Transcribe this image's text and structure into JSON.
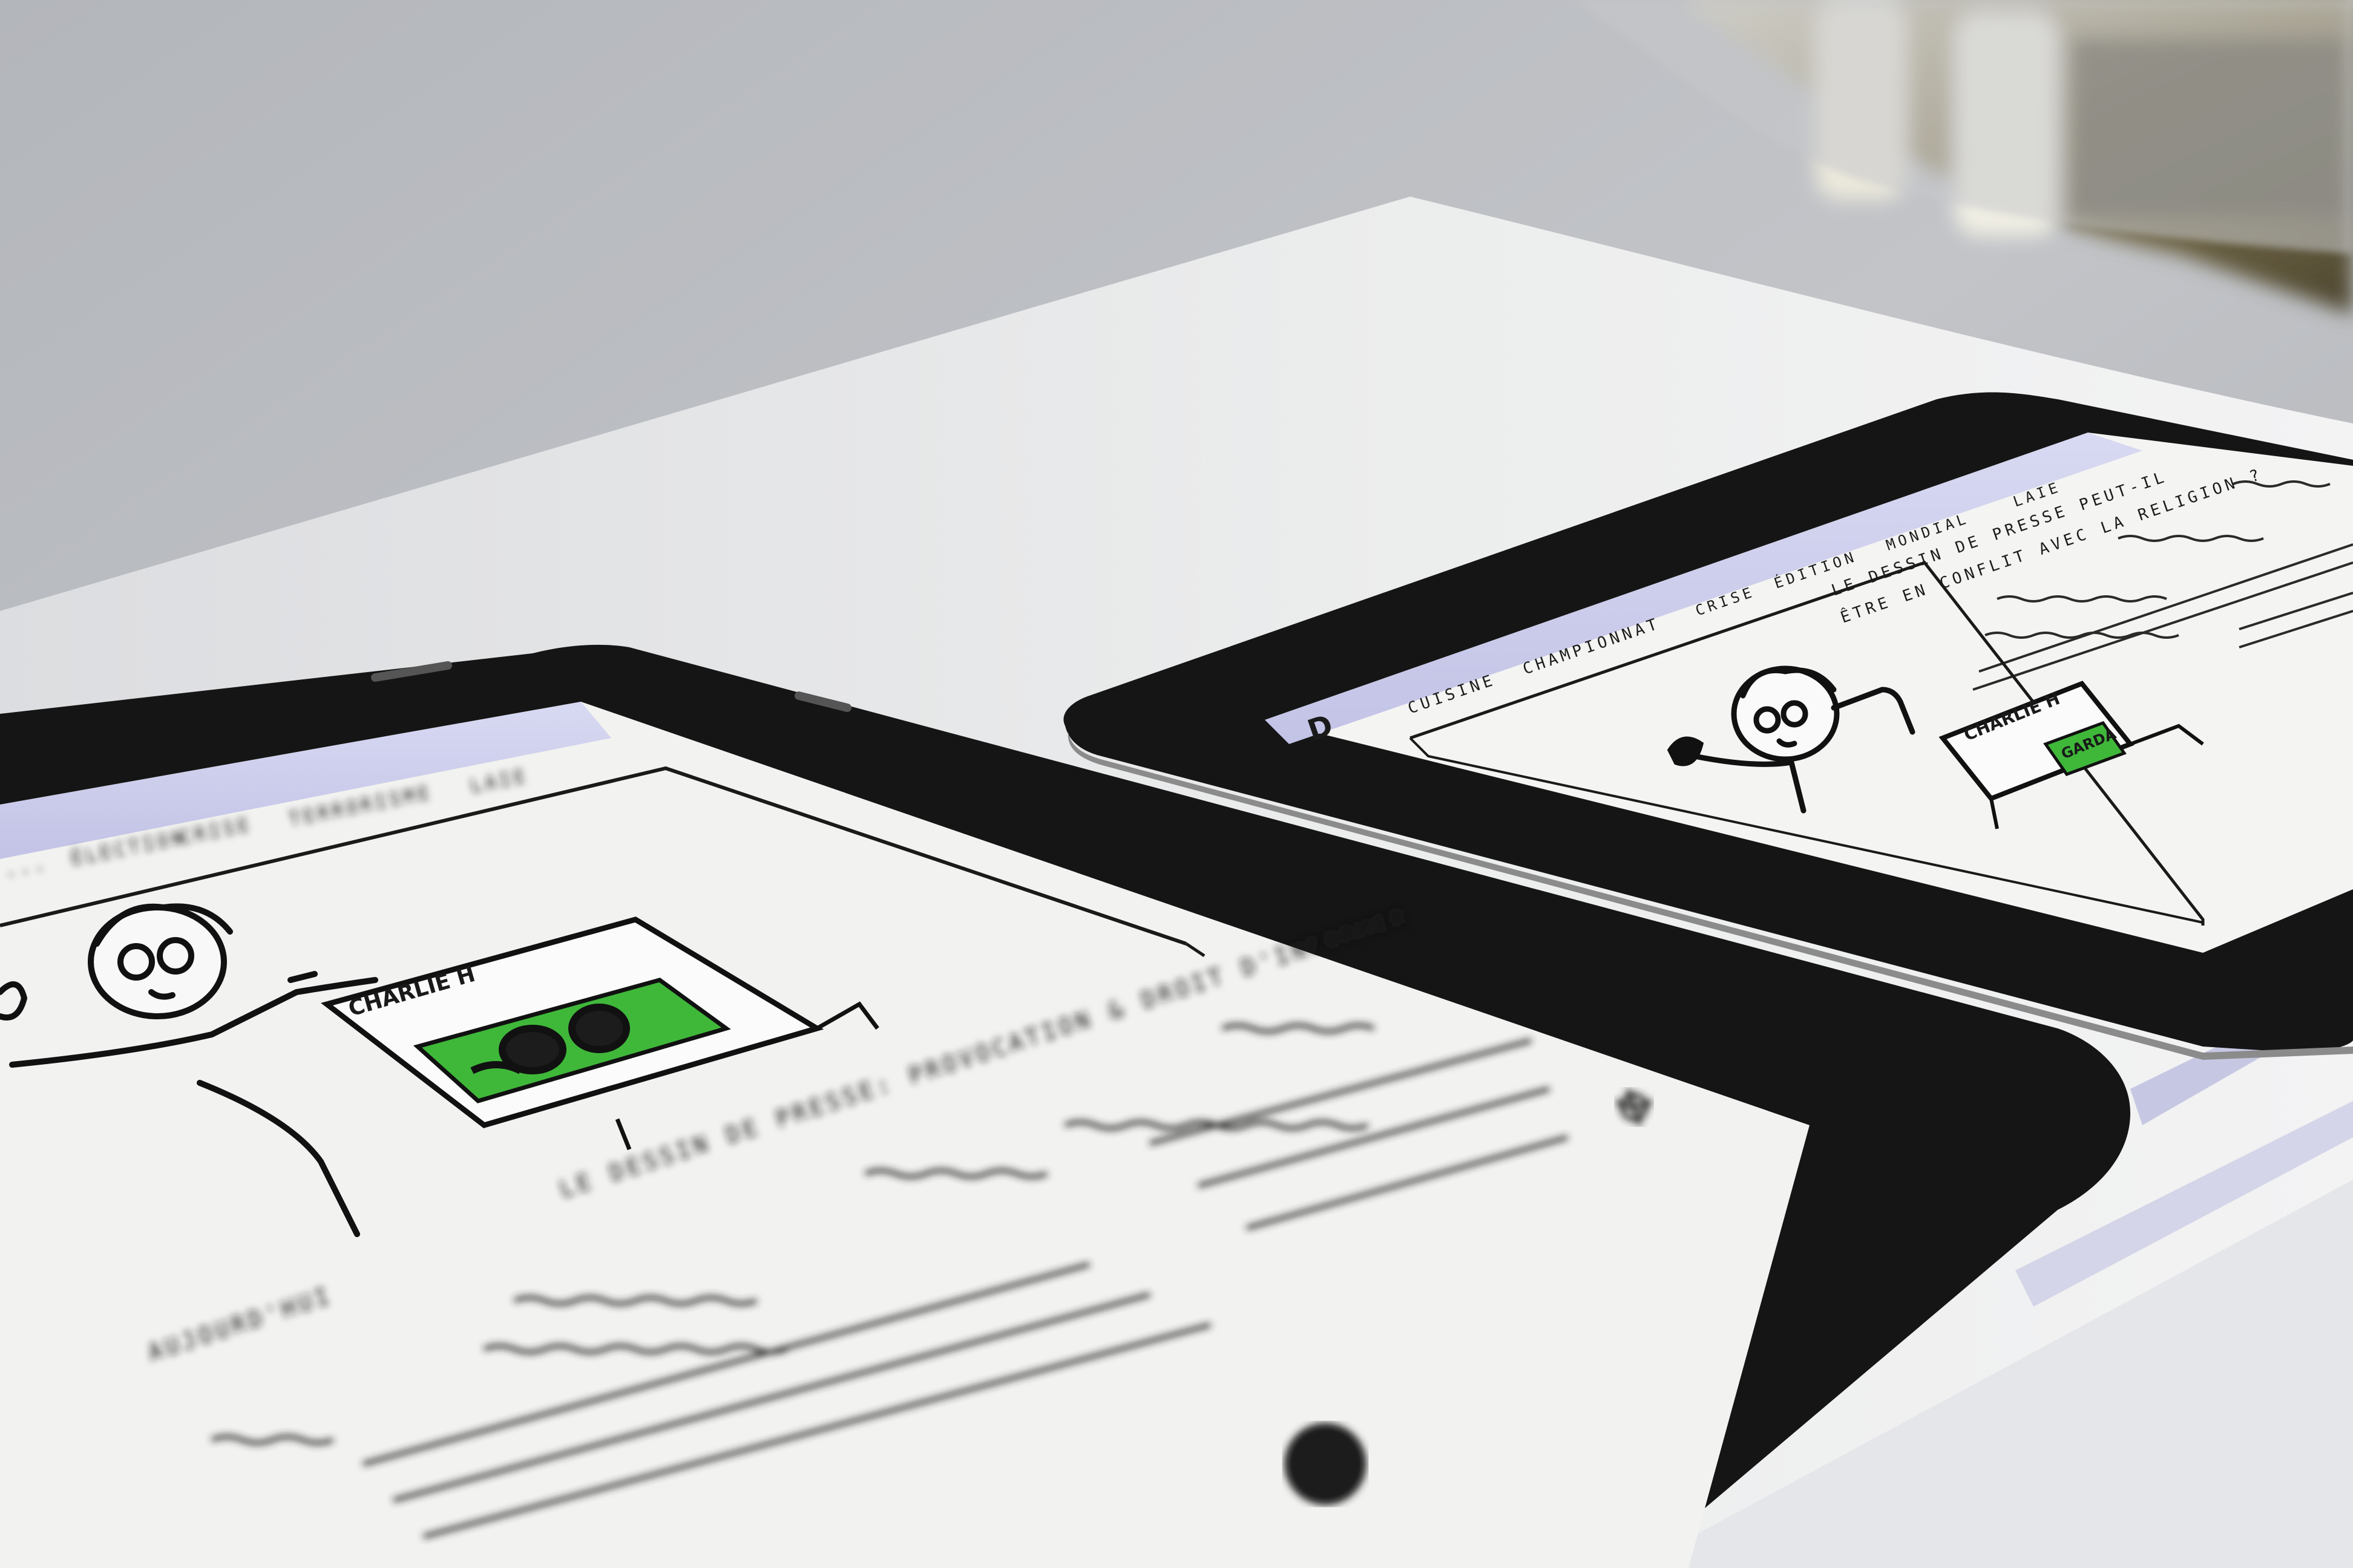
{
  "scene": {
    "description_tags": [
      "paper-prototype",
      "tablet-wireframe"
    ],
    "colors": {
      "desk": "#bcbfc4",
      "paper": "#e9eaec",
      "tablet_bezel": "#151515",
      "nav_bar": "#cfd0ee",
      "highlight_green": "#3fb83a"
    }
  },
  "tablet_front": {
    "nav_items": [
      "...",
      "ÉLECTION",
      "CRISE",
      "TERRORISME",
      "LAIE"
    ],
    "headline_line1": "LE DESSIN DE PRESSE: PROVOCATION & DROIT D'INFORMER",
    "headline_line2": "AUJOURD'HUI",
    "sign_label": "CHARLIE H",
    "icon": "hand-drawn-logo"
  },
  "tablet_back": {
    "nav_logo_letter": "D",
    "nav_items": [
      "CUISINE",
      "CHAMPIONNAT",
      "CRISE",
      "ÉDITION",
      "MONDIAL",
      "LAIE"
    ],
    "intro_line1": "LE DESSIN DE PRESSE PEUT-IL",
    "intro_line2": "ÊTRE EN CONFLIT AVEC LA RELIGION ?",
    "sign_label": "CHARLIE H",
    "sign_art": "GARDA"
  }
}
